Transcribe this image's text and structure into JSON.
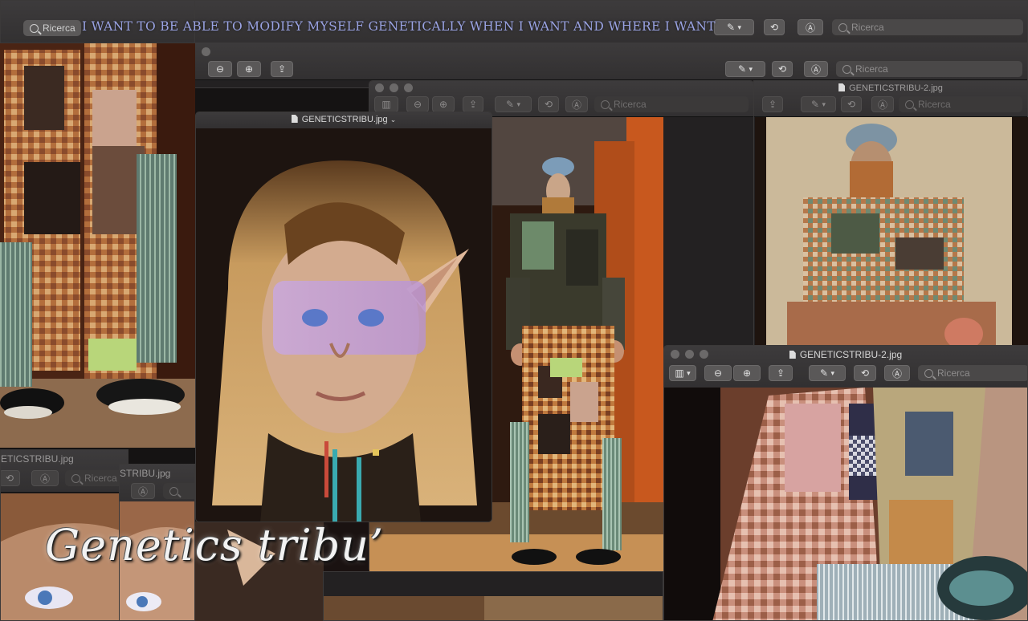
{
  "banner": {
    "text": "I WANT TO BE ABLE TO MODIFY MYSELF GENETICALLY WHEN I WANT AND WHERE I WANT"
  },
  "watermark": {
    "text": "Genetics tribu’"
  },
  "search": {
    "placeholder": "Ricerca"
  },
  "windows": {
    "main": {
      "title": "GENETICSTRIBU.jpg"
    },
    "right_back": {
      "title": "GENETICSTRIBU-2.jpg"
    },
    "right_front": {
      "title": "GENETICSTRIBU-2.jpg"
    },
    "bottom_left_a": {
      "title": "ETICSTRIBU.jpg"
    },
    "bottom_left_b": {
      "title": "STRIBU.jpg"
    }
  },
  "icons": {
    "sidebar": "sidebar-icon",
    "zoom_out": "zoom-out-icon",
    "zoom_in": "zoom-in-icon",
    "share": "share-icon",
    "markup": "markup-pen-icon",
    "rotate": "rotate-icon",
    "annotate": "annotate-circle-a-icon",
    "search": "search-icon"
  },
  "colors": {
    "banner_text": "#9aa3e3",
    "window_bg": "#232122",
    "toolbar": "#353334"
  }
}
